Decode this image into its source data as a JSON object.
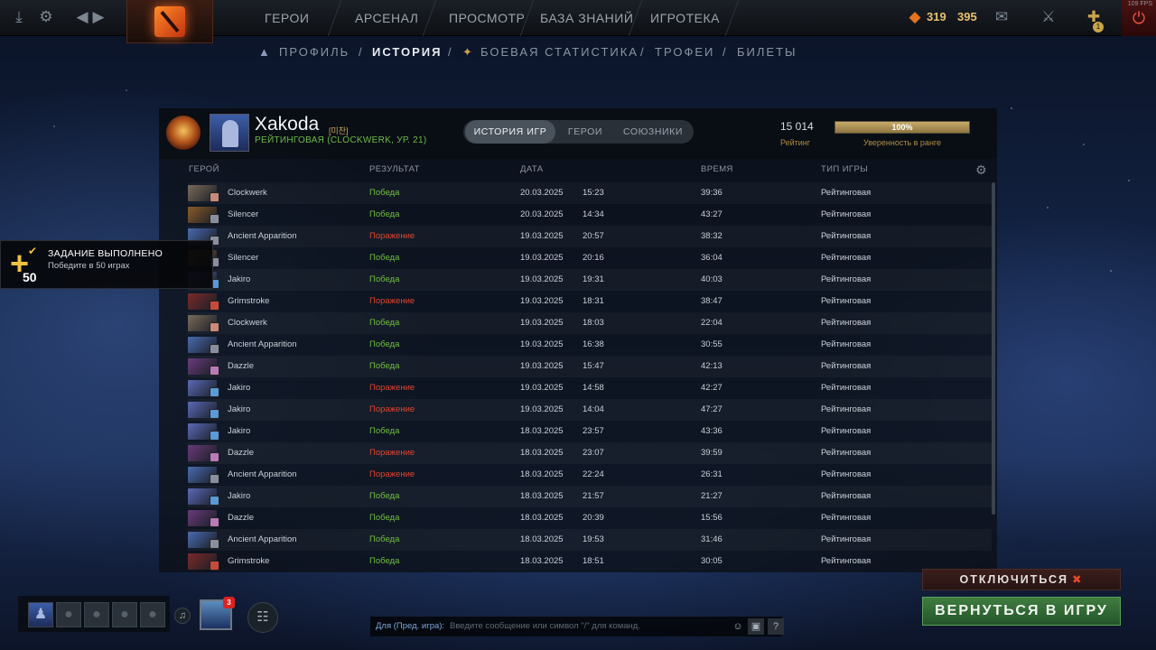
{
  "topbar": {
    "nav": [
      "ГЕРОИ",
      "АРСЕНАЛ",
      "ПРОСМОТР",
      "БАЗА ЗНАНИЙ",
      "ИГРОТЕКА"
    ],
    "shards": "319",
    "gold": "395",
    "fps": "109 FPS",
    "notif_count": "1",
    "icons": [
      "download-icon",
      "gear-icon",
      "back-arrow-icon",
      "forward-arrow-icon",
      "shard-icon",
      "mail-icon",
      "armory-icon",
      "plus-shield-icon",
      "power-icon"
    ]
  },
  "subnav": {
    "items": [
      "ПРОФИЛЬ",
      "/",
      "ИСТОРИЯ",
      "/",
      "БОЕВАЯ СТАТИСТИКА",
      "/",
      "ТРОФЕИ",
      "/",
      "БИЛЕТЫ"
    ],
    "active": "ИСТОРИЯ"
  },
  "profile": {
    "name": "Xakoda",
    "tag": "[미찬]",
    "subtitle": "РЕЙТИНГОВАЯ (CLOCKWERK, УР. 21)",
    "rating_value": "15 014",
    "rating_label": "Рейтинг",
    "confidence_percent": 100,
    "confidence_text": "100%",
    "confidence_label": "Уверенность в ранге"
  },
  "tabs": [
    "ИСТОРИЯ ИГР",
    "ГЕРОИ",
    "СОЮЗНИКИ"
  ],
  "table": {
    "columns": [
      "ГЕРОЙ",
      "РЕЗУЛЬТАТ",
      "ДАТА",
      "ВРЕМЯ",
      "ТИП ИГРЫ"
    ],
    "rows": [
      {
        "hero": "Clockwerk",
        "result": "Победа",
        "win": true,
        "date": "20.03.2025",
        "time": "15:23",
        "duration": "39:36",
        "type": "Рейтинговая",
        "color": "#7a6a5a",
        "badge": "#c98a7a"
      },
      {
        "hero": "Silencer",
        "result": "Победа",
        "win": true,
        "date": "20.03.2025",
        "time": "14:34",
        "duration": "43:27",
        "type": "Рейтинговая",
        "color": "#8a5a2a",
        "badge": "#8a8fa0"
      },
      {
        "hero": "Ancient Apparition",
        "result": "Поражение",
        "win": false,
        "date": "19.03.2025",
        "time": "20:57",
        "duration": "38:32",
        "type": "Рейтинговая",
        "color": "#4a6ab0",
        "badge": "#8a8fa0"
      },
      {
        "hero": "Silencer",
        "result": "Победа",
        "win": true,
        "date": "19.03.2025",
        "time": "20:16",
        "duration": "36:04",
        "type": "Рейтинговая",
        "color": "#8a5a2a",
        "badge": "#8a8fa0"
      },
      {
        "hero": "Jakiro",
        "result": "Победа",
        "win": true,
        "date": "19.03.2025",
        "time": "19:31",
        "duration": "40:03",
        "type": "Рейтинговая",
        "color": "#5a6ab8",
        "badge": "#5a9ad8"
      },
      {
        "hero": "Grimstroke",
        "result": "Поражение",
        "win": false,
        "date": "19.03.2025",
        "time": "18:31",
        "duration": "38:47",
        "type": "Рейтинговая",
        "color": "#7a2a2a",
        "badge": "#c84a3a"
      },
      {
        "hero": "Clockwerk",
        "result": "Победа",
        "win": true,
        "date": "19.03.2025",
        "time": "18:03",
        "duration": "22:04",
        "type": "Рейтинговая",
        "color": "#7a6a5a",
        "badge": "#c98a7a"
      },
      {
        "hero": "Ancient Apparition",
        "result": "Победа",
        "win": true,
        "date": "19.03.2025",
        "time": "16:38",
        "duration": "30:55",
        "type": "Рейтинговая",
        "color": "#4a6ab0",
        "badge": "#8a8fa0"
      },
      {
        "hero": "Dazzle",
        "result": "Победа",
        "win": true,
        "date": "19.03.2025",
        "time": "15:47",
        "duration": "42:13",
        "type": "Рейтинговая",
        "color": "#6a3a7a",
        "badge": "#b87ab8"
      },
      {
        "hero": "Jakiro",
        "result": "Поражение",
        "win": false,
        "date": "19.03.2025",
        "time": "14:58",
        "duration": "42:27",
        "type": "Рейтинговая",
        "color": "#5a6ab8",
        "badge": "#5a9ad8"
      },
      {
        "hero": "Jakiro",
        "result": "Поражение",
        "win": false,
        "date": "19.03.2025",
        "time": "14:04",
        "duration": "47:27",
        "type": "Рейтинговая",
        "color": "#5a6ab8",
        "badge": "#5a9ad8"
      },
      {
        "hero": "Jakiro",
        "result": "Победа",
        "win": true,
        "date": "18.03.2025",
        "time": "23:57",
        "duration": "43:36",
        "type": "Рейтинговая",
        "color": "#5a6ab8",
        "badge": "#5a9ad8"
      },
      {
        "hero": "Dazzle",
        "result": "Поражение",
        "win": false,
        "date": "18.03.2025",
        "time": "23:07",
        "duration": "39:59",
        "type": "Рейтинговая",
        "color": "#6a3a7a",
        "badge": "#b87ab8"
      },
      {
        "hero": "Ancient Apparition",
        "result": "Поражение",
        "win": false,
        "date": "18.03.2025",
        "time": "22:24",
        "duration": "26:31",
        "type": "Рейтинговая",
        "color": "#4a6ab0",
        "badge": "#8a8fa0"
      },
      {
        "hero": "Jakiro",
        "result": "Победа",
        "win": true,
        "date": "18.03.2025",
        "time": "21:57",
        "duration": "21:27",
        "type": "Рейтинговая",
        "color": "#5a6ab8",
        "badge": "#5a9ad8"
      },
      {
        "hero": "Dazzle",
        "result": "Победа",
        "win": true,
        "date": "18.03.2025",
        "time": "20:39",
        "duration": "15:56",
        "type": "Рейтинговая",
        "color": "#6a3a7a",
        "badge": "#b87ab8"
      },
      {
        "hero": "Ancient Apparition",
        "result": "Победа",
        "win": true,
        "date": "18.03.2025",
        "time": "19:53",
        "duration": "31:46",
        "type": "Рейтинговая",
        "color": "#4a6ab0",
        "badge": "#8a8fa0"
      },
      {
        "hero": "Grimstroke",
        "result": "Победа",
        "win": true,
        "date": "18.03.2025",
        "time": "18:51",
        "duration": "30:05",
        "type": "Рейтинговая",
        "color": "#7a2a2a",
        "badge": "#c84a3a"
      }
    ]
  },
  "toast": {
    "title": "ЗАДАНИЕ ВЫПОЛНЕНО",
    "desc": "Победите в 50 играх",
    "amount": "50"
  },
  "party": {
    "hero_badge": "3"
  },
  "chat": {
    "to": "Для (Пред. игра):",
    "placeholder": "Введите сообщение или символ \"/\" для команд."
  },
  "buttons": {
    "disconnect": "ОТКЛЮЧИТЬСЯ",
    "resume": "ВЕРНУТЬСЯ В ИГРУ"
  },
  "colors": {
    "win": "#6fbf3e",
    "loss": "#e0452d",
    "gold": "#b08b45"
  }
}
